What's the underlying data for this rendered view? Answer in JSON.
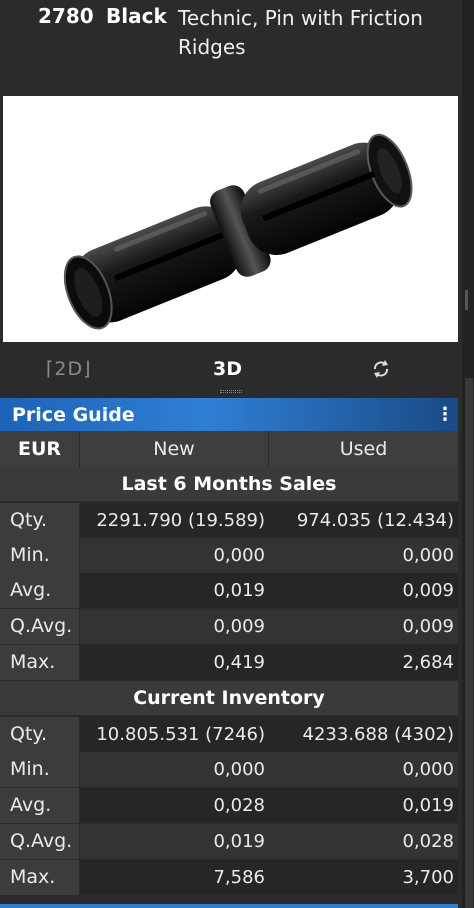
{
  "header": {
    "item_no": "2780",
    "color": "Black",
    "name": "Technic, Pin with Friction Ridges"
  },
  "image": {
    "alt": "Technic pin 3D render"
  },
  "view": {
    "btn_2d": "⌈2D⌋",
    "btn_3d": "3D",
    "rotate_icon": "rotate-icon"
  },
  "price_guide": {
    "title": "Price Guide",
    "menu_glyph": "⋮",
    "columns": {
      "currency": "EUR",
      "new": "New",
      "used": "Used"
    },
    "sections": [
      {
        "title": "Last 6 Months Sales",
        "rows": [
          {
            "label": "Qty.",
            "new": "2291.790 (19.589)",
            "used": "974.035 (12.434)"
          },
          {
            "label": "Min.",
            "new": "0,000",
            "used": "0,000"
          },
          {
            "label": "Avg.",
            "new": "0,019",
            "used": "0,009"
          },
          {
            "label": "Q.Avg.",
            "new": "0,009",
            "used": "0,009"
          },
          {
            "label": "Max.",
            "new": "0,419",
            "used": "2,684"
          }
        ]
      },
      {
        "title": "Current Inventory",
        "rows": [
          {
            "label": "Qty.",
            "new": "10.805.531 (7246)",
            "used": "4233.688 (4302)"
          },
          {
            "label": "Min.",
            "new": "0,000",
            "used": "0,000"
          },
          {
            "label": "Avg.",
            "new": "0,028",
            "used": "0,019"
          },
          {
            "label": "Q.Avg.",
            "new": "0,019",
            "used": "0,028"
          },
          {
            "label": "Max.",
            "new": "7,586",
            "used": "3,700"
          }
        ]
      }
    ]
  },
  "colors": {
    "accent": "#2f7fd6",
    "background": "#2b2b2b"
  }
}
